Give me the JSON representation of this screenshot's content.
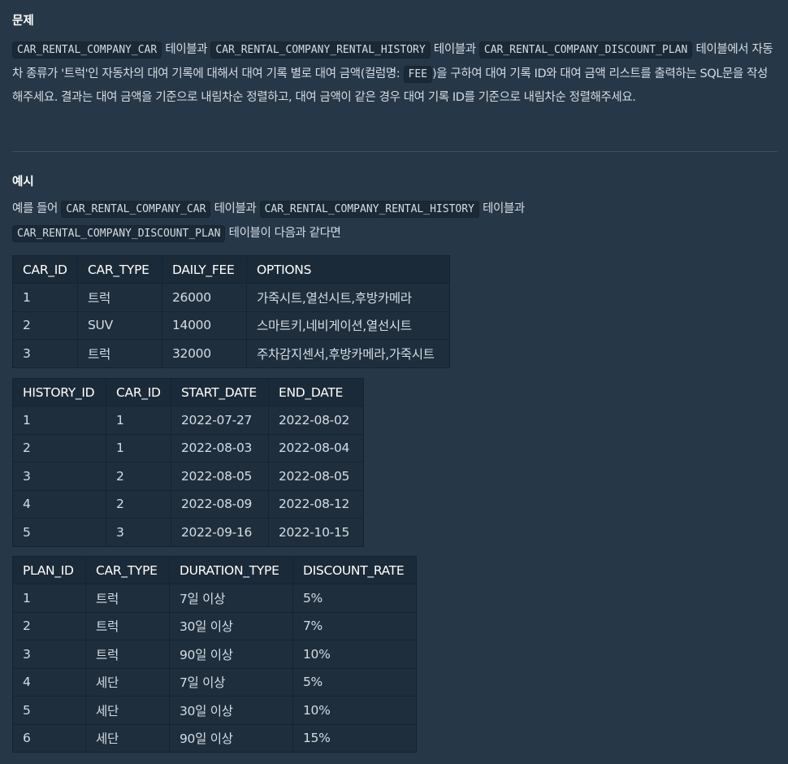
{
  "problem": {
    "heading": "문제",
    "seg1": "테이블과",
    "code_car": "CAR_RENTAL_COMPANY_CAR",
    "code_history": "CAR_RENTAL_COMPANY_RENTAL_HISTORY",
    "seg2": "테이블과",
    "code_plan": "CAR_RENTAL_COMPANY_DISCOUNT_PLAN",
    "seg3": "테이블에서 자동차 종류가 '트럭'인 자동차의 대여 기록에 대해서 대여 기록 별로 대여 금액(컬럼명:",
    "code_fee": "FEE",
    "seg4": ")을 구하여 대여 기록 ID와 대여 금액 리스트를 출력하는 SQL문을 작성해주세요. 결과는 대여 금액을 기준으로 내림차순 정렬하고, 대여 금액이 같은 경우 대여 기록 ID를 기준으로 내림차순 정렬해주세요."
  },
  "example": {
    "heading": "예시",
    "seg1": "예를 들어",
    "code_car": "CAR_RENTAL_COMPANY_CAR",
    "seg2": "테이블과",
    "code_history": "CAR_RENTAL_COMPANY_RENTAL_HISTORY",
    "seg3": "테이블과",
    "code_plan": "CAR_RENTAL_COMPANY_DISCOUNT_PLAN",
    "seg4": "테이블이 다음과 같다면"
  },
  "tables": [
    {
      "headers": [
        "CAR_ID",
        "CAR_TYPE",
        "DAILY_FEE",
        "OPTIONS"
      ],
      "rows": [
        [
          "1",
          "트럭",
          "26000",
          "가죽시트,열선시트,후방카메라"
        ],
        [
          "2",
          "SUV",
          "14000",
          "스마트키,네비게이션,열선시트"
        ],
        [
          "3",
          "트럭",
          "32000",
          "주차감지센서,후방카메라,가죽시트"
        ]
      ]
    },
    {
      "headers": [
        "HISTORY_ID",
        "CAR_ID",
        "START_DATE",
        "END_DATE"
      ],
      "rows": [
        [
          "1",
          "1",
          "2022-07-27",
          "2022-08-02"
        ],
        [
          "2",
          "1",
          "2022-08-03",
          "2022-08-04"
        ],
        [
          "3",
          "2",
          "2022-08-05",
          "2022-08-05"
        ],
        [
          "4",
          "2",
          "2022-08-09",
          "2022-08-12"
        ],
        [
          "5",
          "3",
          "2022-09-16",
          "2022-10-15"
        ]
      ]
    },
    {
      "headers": [
        "PLAN_ID",
        "CAR_TYPE",
        "DURATION_TYPE",
        "DISCOUNT_RATE"
      ],
      "rows": [
        [
          "1",
          "트럭",
          "7일 이상",
          "5%"
        ],
        [
          "2",
          "트럭",
          "30일 이상",
          "7%"
        ],
        [
          "3",
          "트럭",
          "90일 이상",
          "10%"
        ],
        [
          "4",
          "세단",
          "7일 이상",
          "5%"
        ],
        [
          "5",
          "세단",
          "30일 이상",
          "10%"
        ],
        [
          "6",
          "세단",
          "90일 이상",
          "15%"
        ]
      ]
    }
  ]
}
